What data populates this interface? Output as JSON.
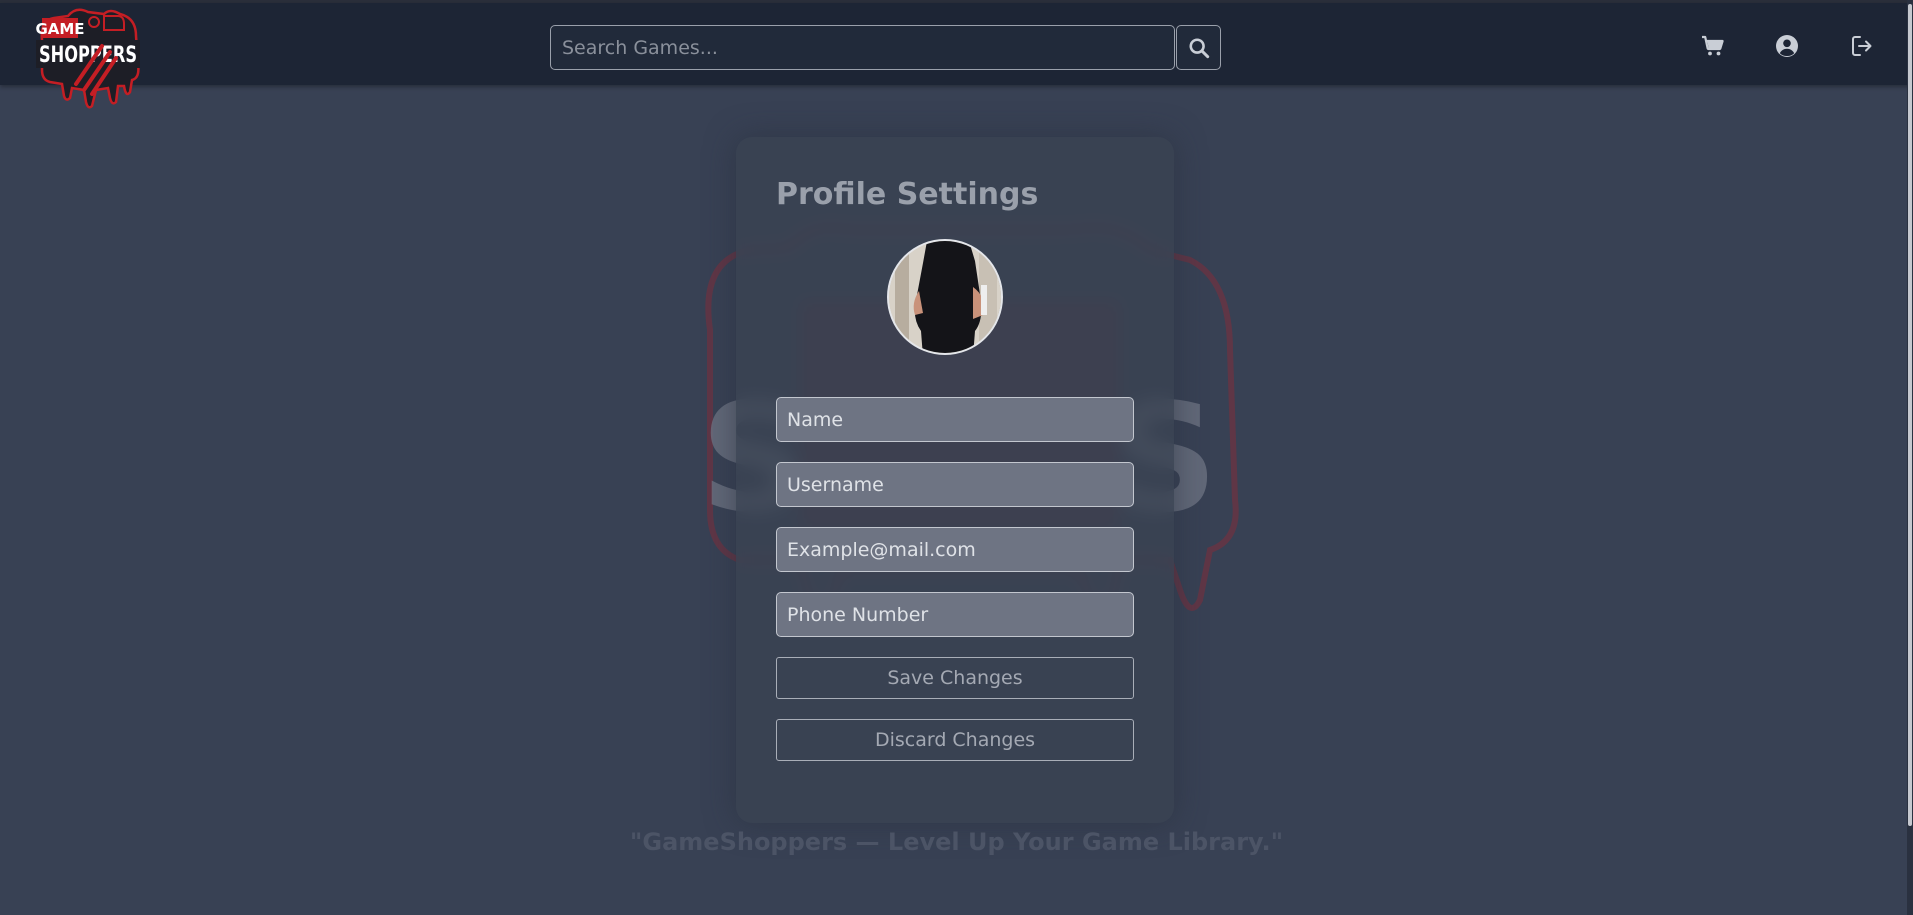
{
  "brand": {
    "logo_alt": "GameShoppers",
    "accent_color": "#c41e24"
  },
  "header": {
    "search": {
      "placeholder": "Search Games...",
      "value": ""
    },
    "icons": [
      "search-icon",
      "cart-icon",
      "user-circle-icon",
      "logout-icon"
    ]
  },
  "profile": {
    "title": "Profile Settings",
    "fields": {
      "name_placeholder": "Name",
      "username_placeholder": "Username",
      "email_placeholder": "Example@mail.com",
      "phone_placeholder": "Phone Number"
    },
    "save_label": "Save Changes",
    "discard_label": "Discard Changes"
  },
  "footer": {
    "tagline": "\"GameShoppers — Level Up Your Game Library.\""
  },
  "colors": {
    "background": "#384154",
    "navbar": "#1d2535",
    "card": "#3a4252"
  }
}
